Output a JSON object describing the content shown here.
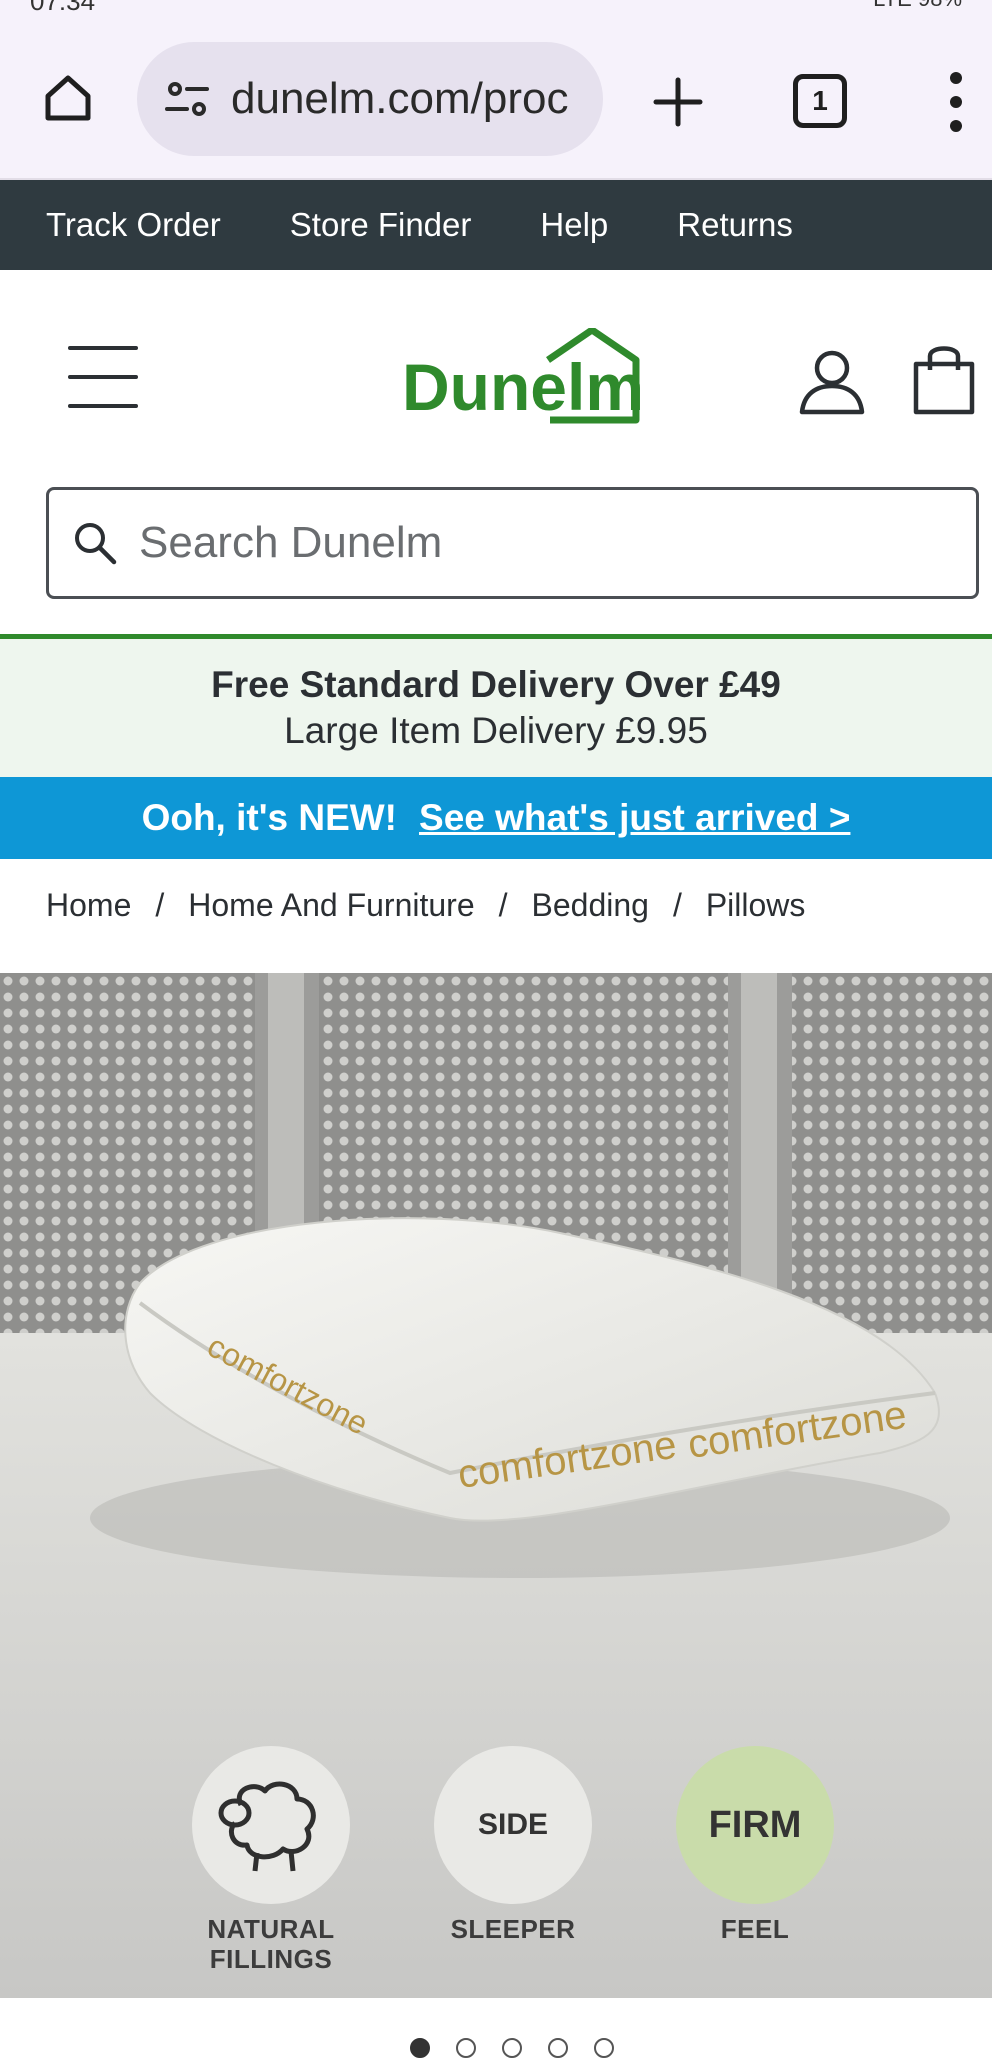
{
  "status_bar": {
    "time": "07:34",
    "right": "LTE 98%"
  },
  "browser": {
    "url": "dunelm.com/proc",
    "tab_count": "1"
  },
  "top_nav": [
    "Track Order",
    "Store Finder",
    "Help",
    "Returns"
  ],
  "header": {
    "logo_text": "Dunelm"
  },
  "search": {
    "placeholder": "Search Dunelm"
  },
  "delivery": {
    "line1": "Free Standard Delivery Over £49",
    "line2": "Large Item Delivery £9.95"
  },
  "promo": {
    "lead": "Ooh, it's NEW!",
    "link": "See what's just arrived >"
  },
  "breadcrumb": [
    "Home",
    "Home And Furniture",
    "Bedding",
    "Pillows"
  ],
  "product_image": {
    "pillow_label": "comfortzone",
    "badges": [
      {
        "icon": "sheep-icon",
        "label_line1": "NATURAL",
        "label_line2": "FILLINGS"
      },
      {
        "icon_text": "SIDE",
        "label_line1": "SLEEPER",
        "label_line2": ""
      },
      {
        "icon_text": "FIRM",
        "label_line1": "FEEL",
        "label_line2": ""
      }
    ]
  },
  "colors": {
    "brand_green": "#2f8a2c",
    "nav_bg": "#2f3a40",
    "promo_blue": "#0e97d6",
    "delivery_bg": "#eef6ee"
  }
}
